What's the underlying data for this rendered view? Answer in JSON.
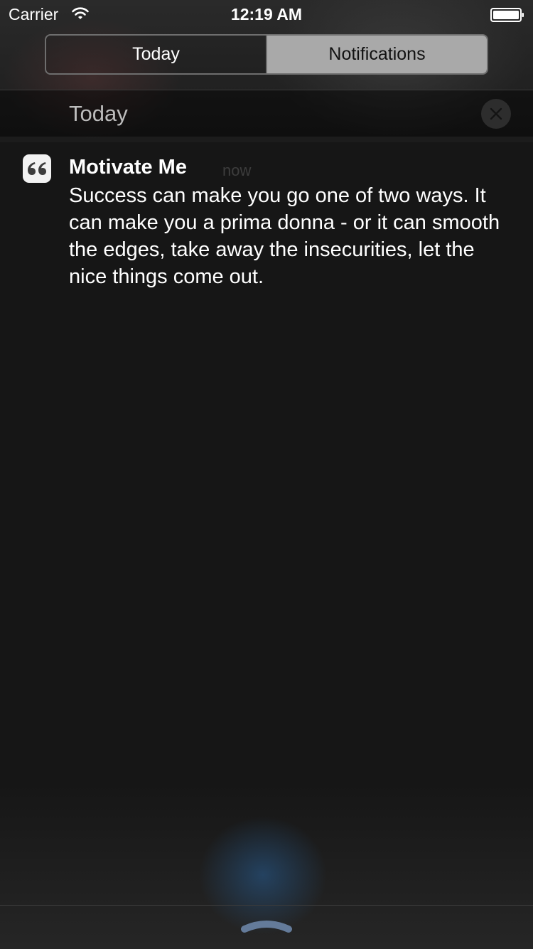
{
  "status_bar": {
    "carrier": "Carrier",
    "time": "12:19 AM",
    "wifi_icon": "wifi-icon",
    "battery_icon": "battery-icon"
  },
  "tabs": [
    {
      "label": "Today",
      "selected": false
    },
    {
      "label": "Notifications",
      "selected": true
    }
  ],
  "section": {
    "title": "Today",
    "clear_icon": "close-icon"
  },
  "notification": {
    "app_icon": "quote-icon",
    "app_name": "Motivate Me",
    "time": "now",
    "message": "Success can make you go one of two ways. It can make you a prima donna - or it can smooth the edges, take away the insecurities, let the nice things come out."
  },
  "grabber_icon": "chevron-up-grabber-icon",
  "colors": {
    "selected_tab_bg": "#a9a9a9",
    "background": "#161616",
    "section_title": "#bdbdbd"
  }
}
